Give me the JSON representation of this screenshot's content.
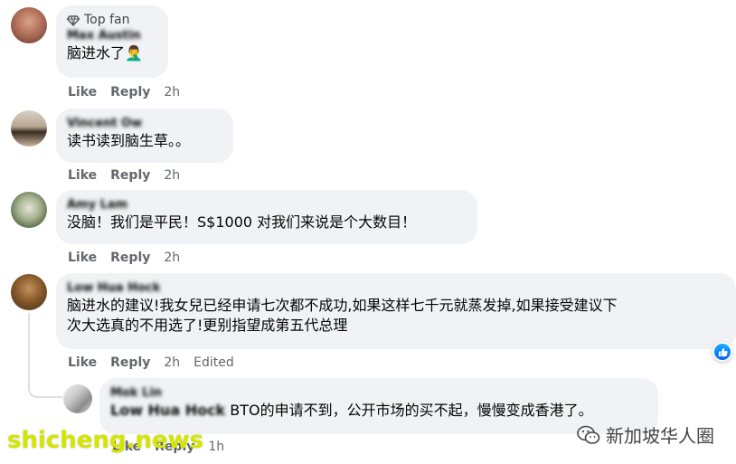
{
  "comments": [
    {
      "badge": "Top fan",
      "author": "Max Austin",
      "text": "脑进水了🤦‍♂️",
      "like": "Like",
      "reply": "Reply",
      "time": "2h"
    },
    {
      "author": "Vincent Ow",
      "text": "读书读到脑生草。。",
      "like": "Like",
      "reply": "Reply",
      "time": "2h"
    },
    {
      "author": "Amy Lam",
      "text": "没脑！我们是平民！S$1000 对我们来说是个大数目！",
      "like": "Like",
      "reply": "Reply",
      "time": "2h"
    },
    {
      "author": "Low Hua Hock",
      "text_line1": "脑进水的建议!我女兒已经申请七次都不成功,如果这样七千元就蒸发掉,如果接受建议下",
      "text_line2": "次大选真的不用选了!更别指望成第五代总理",
      "like": "Like",
      "reply": "Reply",
      "time": "2h",
      "edited": "Edited"
    },
    {
      "author": "Mok Lin",
      "mention": "Low Hua Hock",
      "text": " BTO的申请不到，公开市场的买不起，慢慢变成香港了。",
      "like": "Like",
      "reply": "Reply",
      "time": "1h"
    }
  ],
  "watermark": "shicheng.news",
  "wechat_label": "新加坡华人圈",
  "colors": {
    "bubble": "#f0f2f5",
    "action": "#65676b",
    "like_blue": "#0862f7",
    "watermark": "#d4e600"
  }
}
